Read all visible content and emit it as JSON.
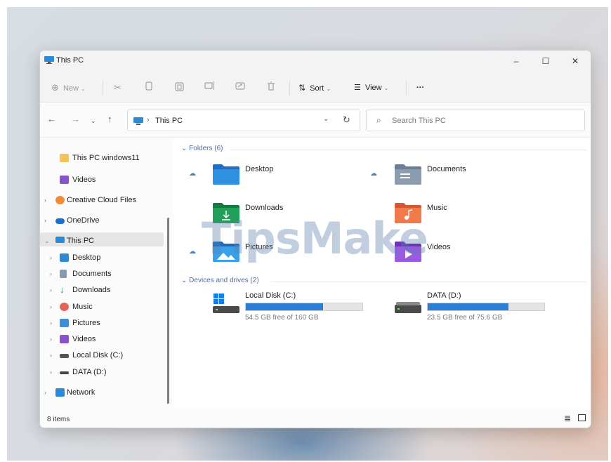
{
  "window": {
    "title": "This PC"
  },
  "titlebar": {
    "minimize": "–",
    "maximize": "☐",
    "close": "✕"
  },
  "toolbar": {
    "new_label": "New",
    "sort_label": "Sort",
    "view_label": "View",
    "more_label": "···"
  },
  "address": {
    "path": "This PC",
    "search_placeholder": "Search This PC"
  },
  "sidebar": {
    "items": [
      {
        "label": "This PC windows11"
      },
      {
        "label": "Videos"
      },
      {
        "label": "Creative Cloud Files"
      },
      {
        "label": "OneDrive"
      },
      {
        "label": "This PC"
      },
      {
        "label": "Desktop"
      },
      {
        "label": "Documents"
      },
      {
        "label": "Downloads"
      },
      {
        "label": "Music"
      },
      {
        "label": "Pictures"
      },
      {
        "label": "Videos"
      },
      {
        "label": "Local Disk (C:)"
      },
      {
        "label": "DATA (D:)"
      },
      {
        "label": "Network"
      }
    ]
  },
  "folders": {
    "header": "Folders (6)",
    "items": [
      {
        "label": "Desktop"
      },
      {
        "label": "Documents"
      },
      {
        "label": "Downloads"
      },
      {
        "label": "Music"
      },
      {
        "label": "Pictures"
      },
      {
        "label": "Videos"
      }
    ]
  },
  "drives": {
    "header": "Devices and drives (2)",
    "items": [
      {
        "label": "Local Disk (C:)",
        "free": "54.5 GB free of 160 GB",
        "used_fraction": 0.66
      },
      {
        "label": "DATA (D:)",
        "free": "23.5 GB free of 75.6 GB",
        "used_fraction": 0.69
      }
    ]
  },
  "watermark": "TipsMake",
  "status": {
    "item_count": "8 items"
  },
  "colors": {
    "accent": "#2a7fd4",
    "folder": "#2f86d6"
  }
}
